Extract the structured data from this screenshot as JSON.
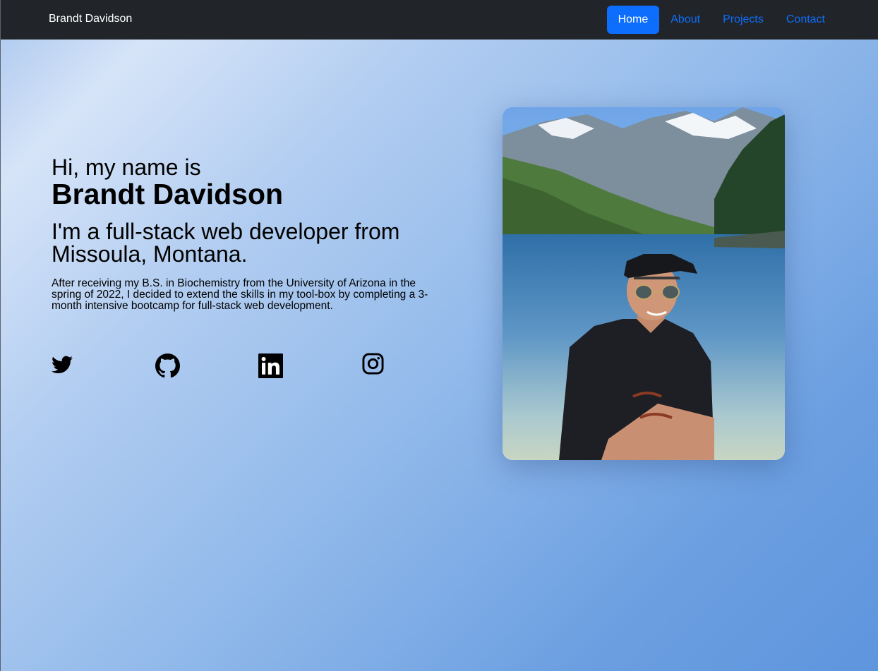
{
  "nav": {
    "brand": "Brandt Davidson",
    "links": [
      {
        "label": "Home",
        "active": true
      },
      {
        "label": "About",
        "active": false
      },
      {
        "label": "Projects",
        "active": false
      },
      {
        "label": "Contact",
        "active": false
      }
    ]
  },
  "hero": {
    "greeting": "Hi, my name is",
    "name": "Brandt Davidson",
    "tagline": "I'm a full-stack web developer from Missoula, Montana.",
    "bio": "After receiving my B.S. in Biochemistry from the University of Arizona in the spring of 2022, I decided to extend the skills in my tool-box by completing a 3-month intensive bootcamp for full-stack web development."
  },
  "socials": [
    {
      "icon": "twitter-icon"
    },
    {
      "icon": "github-icon"
    },
    {
      "icon": "linkedin-icon"
    },
    {
      "icon": "instagram-icon"
    }
  ],
  "photo": {
    "subject": "profile-photo"
  },
  "colors": {
    "navbar_bg": "#212529",
    "accent": "#0d6efd",
    "page_gradient_start": "#d6e4f8",
    "page_gradient_end": "#5e95dd"
  }
}
